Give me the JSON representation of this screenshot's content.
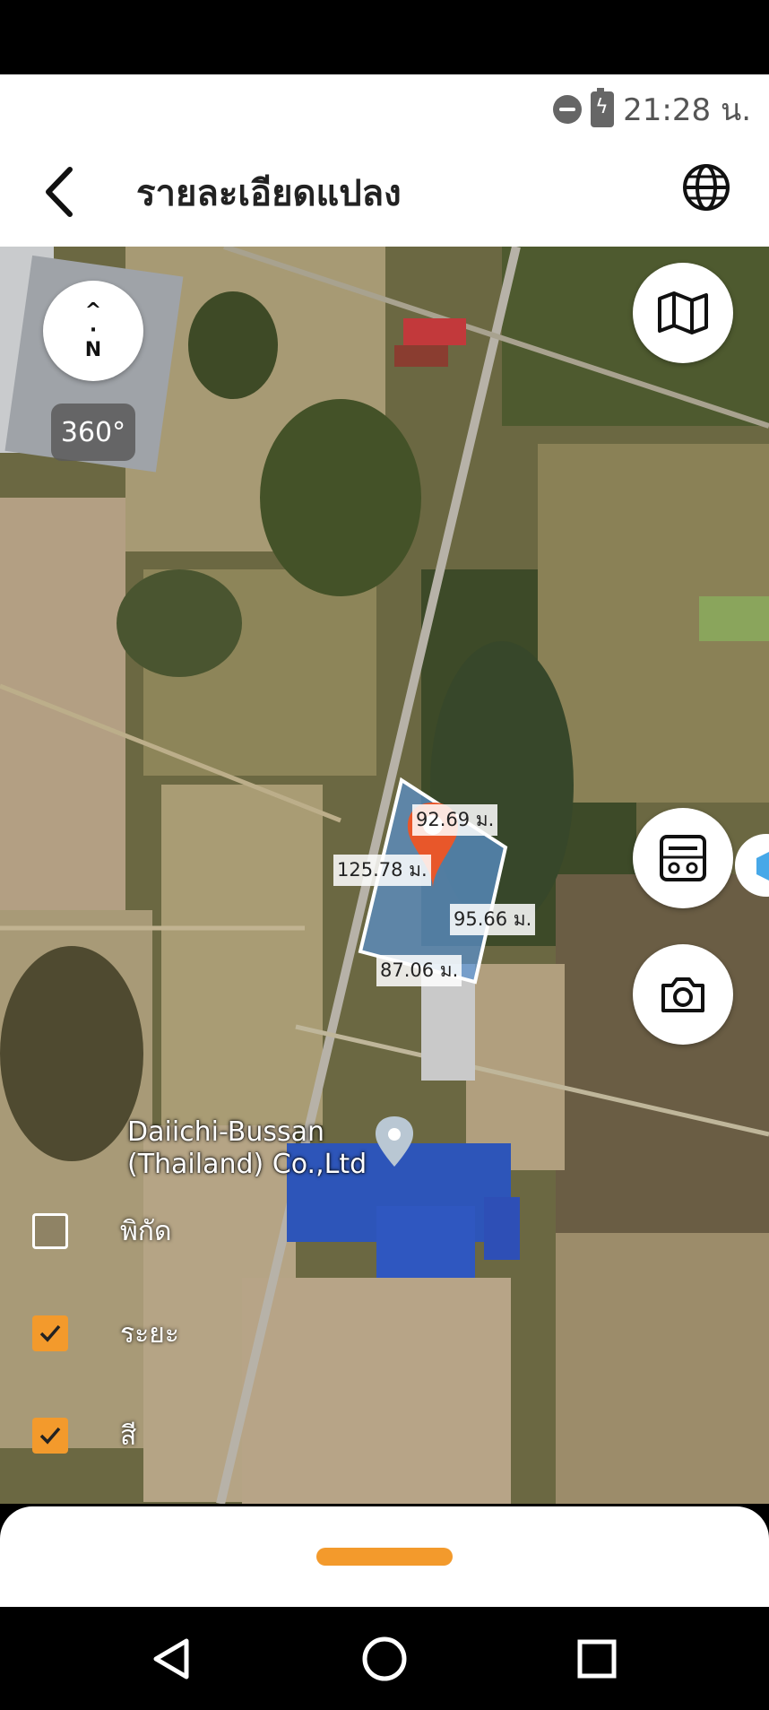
{
  "status_bar": {
    "time": "21:28 น.",
    "icons": [
      "do-not-disturb-icon",
      "battery-charging-icon"
    ]
  },
  "header": {
    "title": "รายละเอียดแปลง",
    "back_icon": "chevron-left-icon",
    "globe_icon": "globe-icon"
  },
  "map": {
    "compass_label": "N",
    "view_360_label": "360°",
    "poi_name_line1": "Daiichi-Bussan",
    "poi_name_line2": "(Thailand) Co.,Ltd",
    "plot_measurements": {
      "top": "92.69 ม.",
      "left": "125.78 ม.",
      "right": "95.66 ม.",
      "bottom": "87.06 ม."
    },
    "buttons": [
      "map-icon",
      "calculator-icon",
      "camera-icon"
    ]
  },
  "layers": [
    {
      "label": "พิกัด",
      "checked": false
    },
    {
      "label": "ระยะ",
      "checked": true
    },
    {
      "label": "สี",
      "checked": true
    }
  ],
  "colors": {
    "accent": "#f39a2c",
    "plot_fill": "#5a8fc9",
    "marker": "#e8572a"
  },
  "nav_bar": [
    "back-triangle-icon",
    "home-circle-icon",
    "recents-square-icon"
  ]
}
